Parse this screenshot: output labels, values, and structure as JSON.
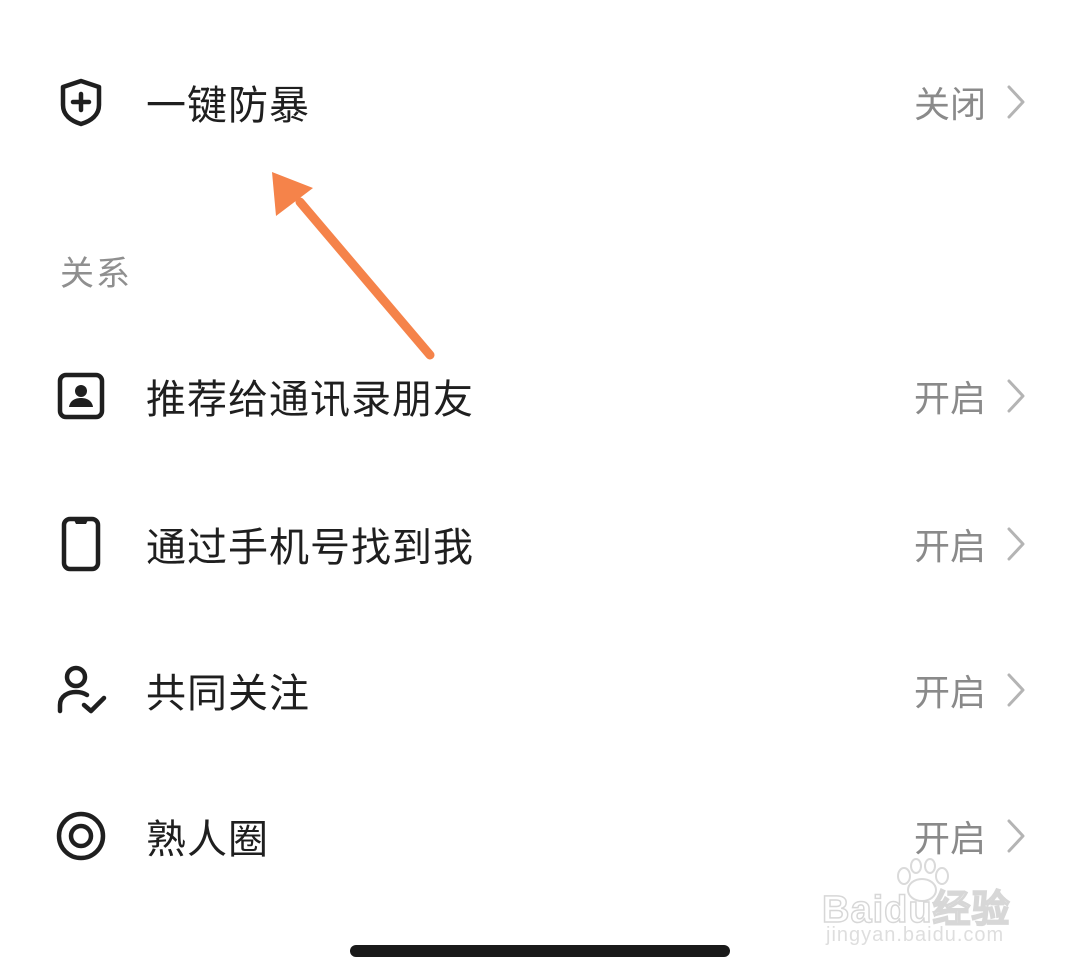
{
  "rows": [
    {
      "label": "一键防暴",
      "status": "关闭",
      "icon": "shield-plus-icon"
    },
    {
      "label": "推荐给通讯录朋友",
      "status": "开启",
      "icon": "contact-card-icon"
    },
    {
      "label": "通过手机号找到我",
      "status": "开启",
      "icon": "phone-icon"
    },
    {
      "label": "共同关注",
      "status": "开启",
      "icon": "user-check-icon"
    },
    {
      "label": "熟人圈",
      "status": "开启",
      "icon": "target-circle-icon"
    }
  ],
  "section": {
    "title": "关系"
  },
  "annotation": {
    "color": "#f5834a"
  },
  "watermark": {
    "main": "Baidu经验",
    "sub": "jingyan.baidu.com"
  }
}
